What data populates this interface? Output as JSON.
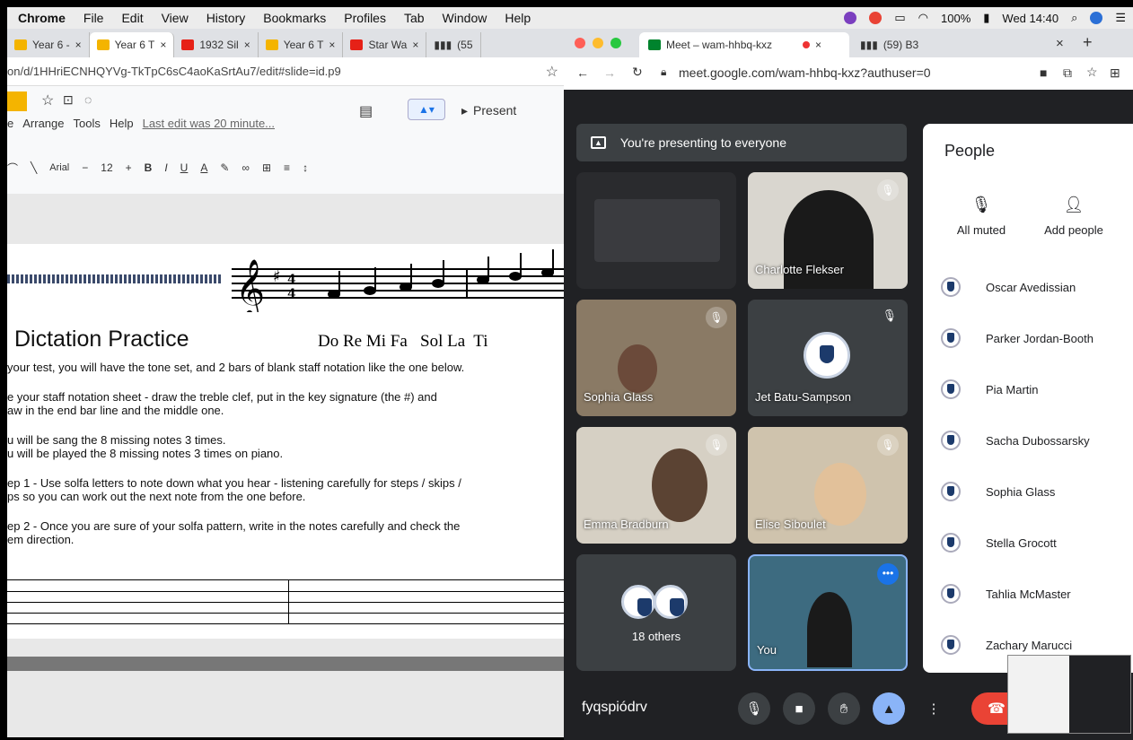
{
  "menubar": {
    "app": "Chrome",
    "items": [
      "File",
      "Edit",
      "View",
      "History",
      "Bookmarks",
      "Profiles",
      "Tab",
      "Window",
      "Help"
    ],
    "battery": "100%",
    "datetime": "Wed 14:40"
  },
  "left_browser": {
    "tabs": [
      {
        "label": "Year 6 -",
        "icon": "slides-icon"
      },
      {
        "label": "Year 6 T",
        "icon": "slides-icon",
        "active": true
      },
      {
        "label": "1932 Sil",
        "icon": "youtube-icon"
      },
      {
        "label": "Year 6 T",
        "icon": "slides-icon"
      },
      {
        "label": "Star Wa",
        "icon": "youtube-icon"
      },
      {
        "label": "(55",
        "icon": "bars-icon"
      }
    ],
    "url": "on/d/1HHriECNHQYVg-TkTpC6sC4aoKaSrtAu7/edit#slide=id.p9",
    "slides": {
      "menu": [
        "e",
        "Arrange",
        "Tools",
        "Help"
      ],
      "last_edit": "Last edit was 20 minute...",
      "present_label": "Present",
      "font": "Arial",
      "font_size": "12"
    },
    "slide": {
      "solfa": "Do Re Mi Fa   Sol La  Ti",
      "title": "Dictation Practice",
      "lines": [
        "your test, you will have the tone set, and 2 bars of blank staff notation like the one below.",
        "e your staff notation sheet - draw the treble clef, put in the key signature (the #) and",
        "aw in the end bar line and the middle one.",
        "u will be sang the 8 missing notes 3 times.",
        "u will be played the 8 missing notes 3 times on piano.",
        "ep 1 - Use solfa letters to note down what you hear - listening carefully for steps / skips /",
        "ps so you can work out the next note from the one before.",
        "ep 2 - Once you are sure of your solfa pattern, write in the notes carefully and check the",
        "em direction."
      ]
    }
  },
  "right_browser": {
    "tabs": [
      {
        "label": "Meet – wam-hhbq-kxz",
        "active": true
      },
      {
        "label": "(59) B3"
      }
    ],
    "url": "meet.google.com/wam-hhbq-kxz?authuser=0",
    "presenting_banner": "You're presenting to everyone",
    "tiles": [
      {
        "name": ""
      },
      {
        "name": "Charlotte Flekser"
      },
      {
        "name": "Sophia Glass"
      },
      {
        "name": "Jet Batu-Sampson"
      },
      {
        "name": "Emma Bradburn"
      },
      {
        "name": "Elise Siboulet"
      },
      {
        "name": "18 others"
      },
      {
        "name": "You"
      }
    ],
    "people_panel": {
      "title": "People",
      "all_muted": "All muted",
      "add_people": "Add people",
      "participants": [
        "Oscar Avedissian",
        "Parker Jordan-Booth",
        "Pia Martin",
        "Sacha Dubossarsky",
        "Sophia Glass",
        "Stella Grocott",
        "Tahlia McMaster",
        "Zachary Marucci"
      ]
    },
    "meeting_code": "fyqspiódrv"
  }
}
